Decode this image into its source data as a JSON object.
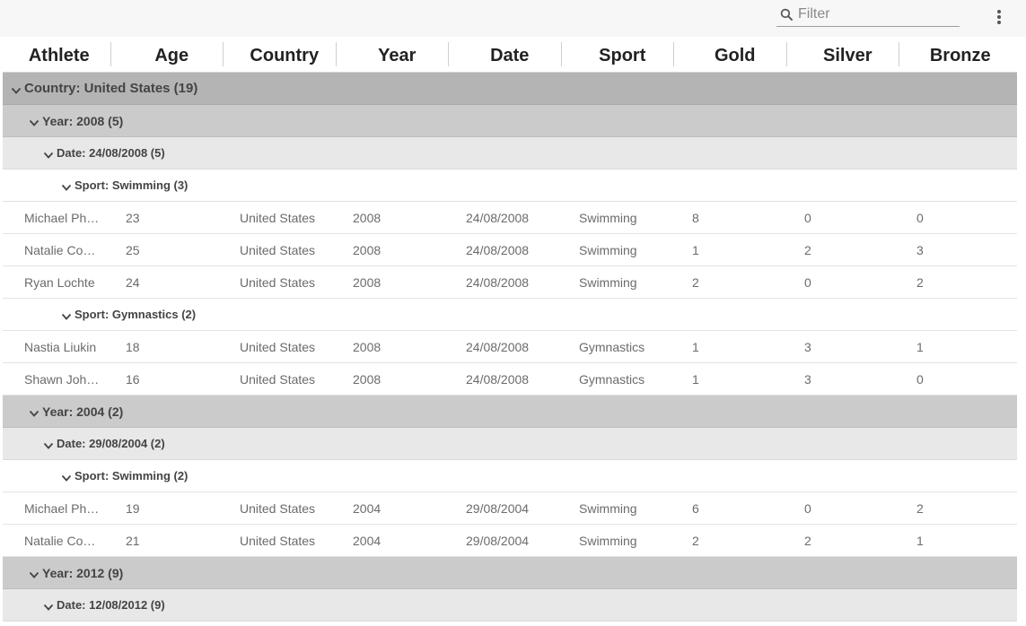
{
  "filter": {
    "placeholder": "Filter"
  },
  "columns": [
    "Athlete",
    "Age",
    "Country",
    "Year",
    "Date",
    "Sport",
    "Gold",
    "Silver",
    "Bronze"
  ],
  "rows": [
    {
      "type": "group",
      "level": 0,
      "label": "Country: United States (19)"
    },
    {
      "type": "group",
      "level": 1,
      "label": "Year: 2008 (5)"
    },
    {
      "type": "group",
      "level": 2,
      "label": "Date: 24/08/2008 (5)"
    },
    {
      "type": "group",
      "level": 3,
      "label": "Sport: Swimming (3)"
    },
    {
      "type": "data",
      "cells": [
        "Michael Ph…",
        "23",
        "United States",
        "2008",
        "24/08/2008",
        "Swimming",
        "8",
        "0",
        "0"
      ]
    },
    {
      "type": "data",
      "cells": [
        "Natalie Cou…",
        "25",
        "United States",
        "2008",
        "24/08/2008",
        "Swimming",
        "1",
        "2",
        "3"
      ]
    },
    {
      "type": "data",
      "cells": [
        "Ryan Lochte",
        "24",
        "United States",
        "2008",
        "24/08/2008",
        "Swimming",
        "2",
        "0",
        "2"
      ]
    },
    {
      "type": "group",
      "level": 3,
      "label": "Sport: Gymnastics (2)"
    },
    {
      "type": "data",
      "cells": [
        "Nastia Liukin",
        "18",
        "United States",
        "2008",
        "24/08/2008",
        "Gymnastics",
        "1",
        "3",
        "1"
      ]
    },
    {
      "type": "data",
      "cells": [
        "Shawn Joh…",
        "16",
        "United States",
        "2008",
        "24/08/2008",
        "Gymnastics",
        "1",
        "3",
        "0"
      ]
    },
    {
      "type": "group",
      "level": 1,
      "label": "Year: 2004 (2)"
    },
    {
      "type": "group",
      "level": 2,
      "label": "Date: 29/08/2004 (2)"
    },
    {
      "type": "group",
      "level": 3,
      "label": "Sport: Swimming (2)"
    },
    {
      "type": "data",
      "cells": [
        "Michael Ph…",
        "19",
        "United States",
        "2004",
        "29/08/2004",
        "Swimming",
        "6",
        "0",
        "2"
      ]
    },
    {
      "type": "data",
      "cells": [
        "Natalie Cou…",
        "21",
        "United States",
        "2004",
        "29/08/2004",
        "Swimming",
        "2",
        "2",
        "1"
      ]
    },
    {
      "type": "group",
      "level": 1,
      "label": "Year: 2012 (9)"
    },
    {
      "type": "group",
      "level": 2,
      "label": "Date: 12/08/2012 (9)"
    }
  ],
  "icons": {
    "filter": "search-icon",
    "menu": "more-vertical-icon",
    "group_toggle": "chevron-down-icon"
  },
  "colors": {
    "group_level_0": "#b4b4b4",
    "group_level_1": "#cbcbcb",
    "group_level_2": "#e8e8e8",
    "cell_text": "#6b6b6b"
  }
}
